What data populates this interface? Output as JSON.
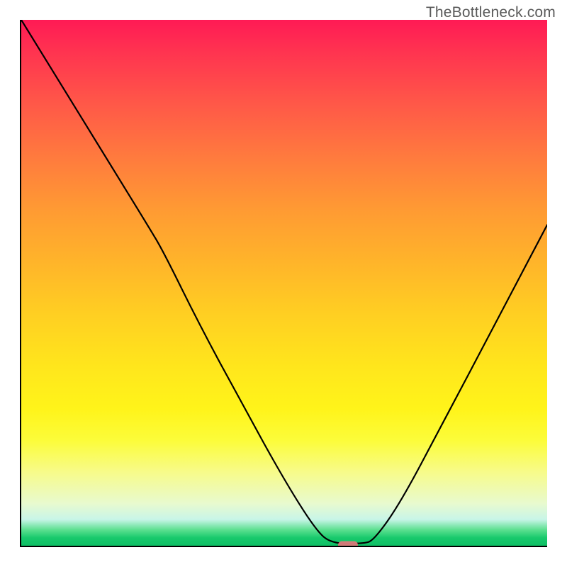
{
  "watermark": "TheBottleneck.com",
  "marker": {
    "x_frac": 0.62,
    "y_frac": 0.996
  },
  "chart_data": {
    "type": "line",
    "title": "",
    "xlabel": "",
    "ylabel": "",
    "xlim": [
      0,
      1
    ],
    "ylim": [
      0,
      1
    ],
    "background": {
      "type": "vertical_gradient",
      "stops": [
        {
          "pos": 0.0,
          "color": "#ff1a55"
        },
        {
          "pos": 0.16,
          "color": "#ff5848"
        },
        {
          "pos": 0.36,
          "color": "#ff9a33"
        },
        {
          "pos": 0.56,
          "color": "#ffcf22"
        },
        {
          "pos": 0.74,
          "color": "#fff41a"
        },
        {
          "pos": 0.86,
          "color": "#f7fb8a"
        },
        {
          "pos": 0.95,
          "color": "#c8f5e8"
        },
        {
          "pos": 1.0,
          "color": "#0fbf65"
        }
      ]
    },
    "series": [
      {
        "name": "bottleneck-curve",
        "color": "#000000",
        "width": 2,
        "x": [
          0.0,
          0.08,
          0.16,
          0.24,
          0.27,
          0.34,
          0.42,
          0.5,
          0.56,
          0.59,
          0.65,
          0.67,
          0.72,
          0.8,
          0.9,
          1.0
        ],
        "y": [
          1.0,
          0.87,
          0.74,
          0.61,
          0.56,
          0.418,
          0.27,
          0.125,
          0.03,
          0.004,
          0.004,
          0.01,
          0.08,
          0.23,
          0.42,
          0.61
        ]
      }
    ],
    "marker": {
      "x": 0.62,
      "y": 0.004,
      "color": "#d87b7b",
      "shape": "pill"
    }
  }
}
